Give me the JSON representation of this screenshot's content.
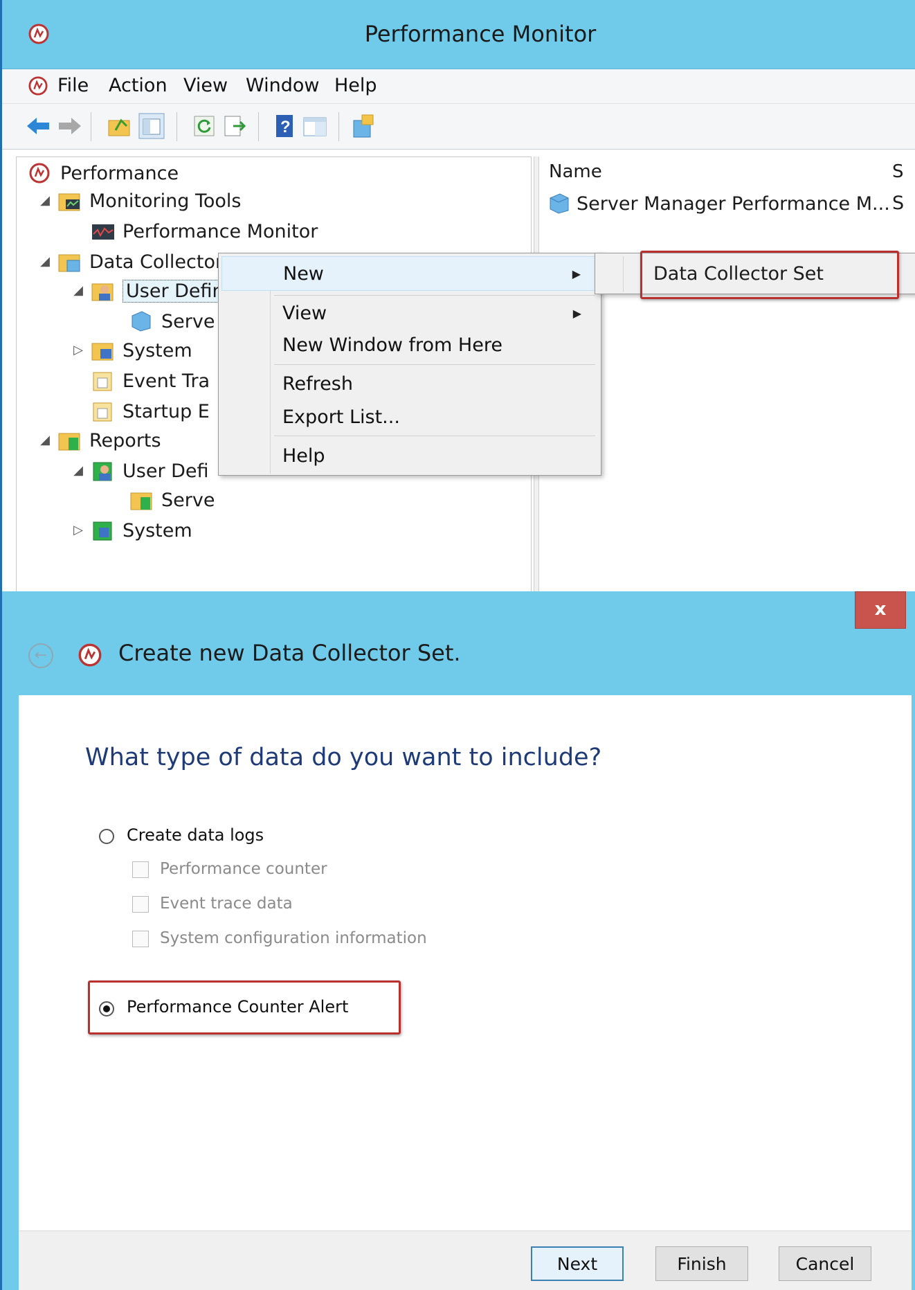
{
  "window": {
    "title": "Performance Monitor"
  },
  "menu": {
    "items": [
      "File",
      "Action",
      "View",
      "Window",
      "Help"
    ]
  },
  "tree": {
    "items": [
      {
        "label": "Performance"
      },
      {
        "label": "Monitoring Tools"
      },
      {
        "label": "Performance Monitor"
      },
      {
        "label": "Data Collector Sets"
      },
      {
        "label": "User Defined"
      },
      {
        "label": "Serve"
      },
      {
        "label": "System"
      },
      {
        "label": "Event Tra"
      },
      {
        "label": "Startup E"
      },
      {
        "label": "Reports"
      },
      {
        "label": "User Defi"
      },
      {
        "label": "Serve"
      },
      {
        "label": "System"
      }
    ]
  },
  "list": {
    "columns": [
      "Name",
      "S"
    ],
    "rows": [
      {
        "name": "Server Manager Performance M...",
        "status": "S"
      }
    ]
  },
  "context_menu": {
    "items": [
      "New",
      "View",
      "New Window from Here",
      "Refresh",
      "Export List...",
      "Help"
    ],
    "submenu_item": "Data Collector Set"
  },
  "wizard": {
    "close_label": "x",
    "title": "Create new Data Collector Set.",
    "question": "What type of data do you want to include?",
    "option_logs": "Create data logs",
    "checkboxes": [
      "Performance counter",
      "Event trace data",
      "System configuration information"
    ],
    "option_alert": "Performance Counter Alert",
    "selected_option": "Performance Counter Alert",
    "buttons": {
      "next": "Next",
      "finish": "Finish",
      "cancel": "Cancel"
    }
  },
  "colors": {
    "titlebar": "#6fcbe9",
    "highlight": "#b8312f",
    "question": "#1e3b78"
  }
}
